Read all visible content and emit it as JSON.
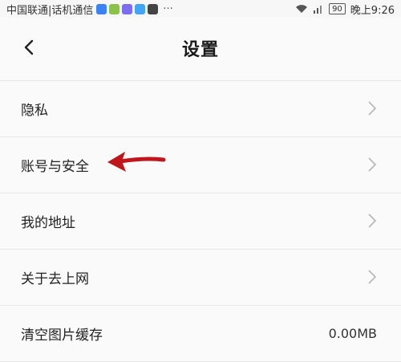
{
  "status_bar": {
    "carrier": "中国联通|话机通信",
    "more": "···",
    "battery": "90",
    "time": "晚上9:26"
  },
  "header": {
    "title": "设置",
    "back_icon": "chevron-left-icon"
  },
  "settings": {
    "items": [
      {
        "label": "隐私",
        "icon": "chevron-right-icon"
      },
      {
        "label": "账号与安全",
        "icon": "chevron-right-icon"
      },
      {
        "label": "我的地址",
        "icon": "chevron-right-icon"
      },
      {
        "label": "关于去上网",
        "icon": "chevron-right-icon"
      },
      {
        "label": "清空图片缓存",
        "value": "0.00MB"
      }
    ]
  },
  "annotation": {
    "arrow_color": "#c0161b"
  }
}
